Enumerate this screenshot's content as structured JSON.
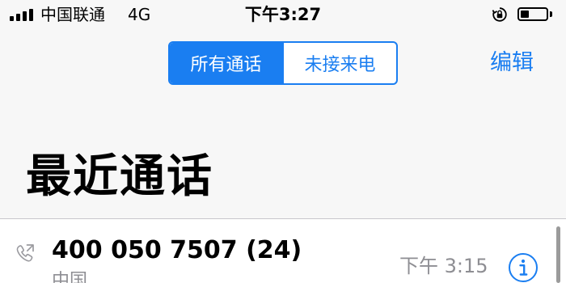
{
  "status_bar": {
    "carrier": "中国联通",
    "network": "4G",
    "time": "下午3:27",
    "battery_level": 0.32
  },
  "header": {
    "segments": [
      {
        "label": "所有通话",
        "selected": true
      },
      {
        "label": "未接来电",
        "selected": false
      }
    ],
    "edit_label": "编辑"
  },
  "title": "最近通话",
  "calls": [
    {
      "name": "400 050 7507 (24)",
      "location": "中国",
      "time": "下午 3:15",
      "call_type_icon": "outgoing-call-icon",
      "info_icon": "info-icon"
    }
  ],
  "colors": {
    "accent": "#1a7ef1",
    "secondary_text": "#8e8e93",
    "background": "#f7f7f7"
  }
}
